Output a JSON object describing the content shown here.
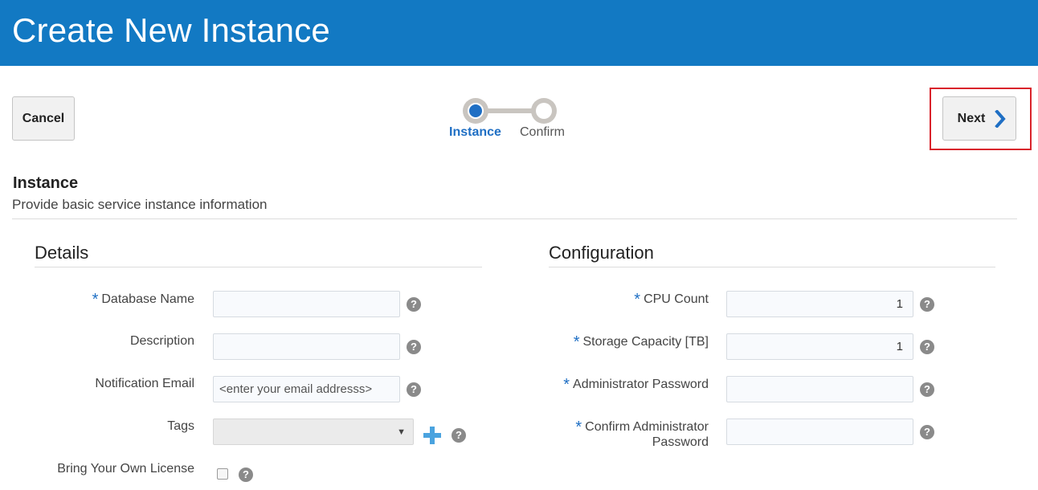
{
  "header": {
    "title": "Create New Instance"
  },
  "toolbar": {
    "cancel_label": "Cancel",
    "next_label": "Next"
  },
  "train": {
    "steps": [
      {
        "label": "Instance",
        "state": "current"
      },
      {
        "label": "Confirm",
        "state": "upcoming"
      }
    ]
  },
  "section": {
    "title": "Instance",
    "subtitle": "Provide basic service instance information"
  },
  "details": {
    "title": "Details",
    "database_name": {
      "label": "Database Name",
      "required": "*",
      "value": ""
    },
    "description": {
      "label": "Description",
      "value": ""
    },
    "notification_email": {
      "label": "Notification Email",
      "placeholder": "<enter your email addresss>"
    },
    "tags": {
      "label": "Tags",
      "value": ""
    },
    "byol": {
      "label": "Bring Your Own License",
      "checked": false
    }
  },
  "configuration": {
    "title": "Configuration",
    "cpu_count": {
      "label": "CPU Count",
      "required": "*",
      "value": "1"
    },
    "storage_capacity": {
      "label": "Storage Capacity [TB]",
      "required": "*",
      "value": "1"
    },
    "admin_password": {
      "label": "Administrator Password",
      "required": "*",
      "value": ""
    },
    "confirm_password": {
      "label_line1": "Confirm Administrator",
      "label_line2": "Password",
      "required": "*",
      "value": ""
    }
  },
  "icons": {
    "help": "?",
    "dropdown_arrow": "▼"
  },
  "colors": {
    "header_bg": "#1279c3",
    "accent": "#1f6fc4",
    "highlight_border": "#d9232b",
    "add_icon": "#4aa3df"
  }
}
